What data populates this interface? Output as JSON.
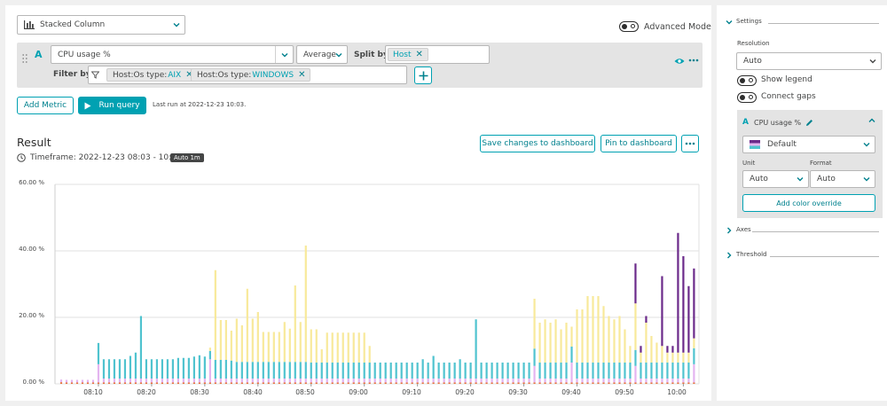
{
  "toolbar": {
    "chart_type": "Stacked Column",
    "advanced_mode": "Advanced Mode"
  },
  "query": {
    "letter": "A",
    "metric": "CPU usage %",
    "aggregation": "Average",
    "split_by_label": "Split by",
    "split_by_value": "Host",
    "filter_by_label": "Filter by",
    "filters": [
      {
        "key": "Host:Os type: ",
        "value": "AIX"
      },
      {
        "key": "Host:Os type: ",
        "value": "WINDOWS"
      }
    ]
  },
  "actions": {
    "add_metric": "Add Metric",
    "run_query": "Run query",
    "last_run": "Last run at 2022-12-23 10:03."
  },
  "result": {
    "title": "Result",
    "timeframe": "Timeframe: 2022-12-23 08:03 - 10:03",
    "resolution_badge": "Auto 1m",
    "save_button": "Save changes to dashboard",
    "pin_button": "Pin to dashboard"
  },
  "colors": {
    "accent": "#00a1b2",
    "cyan": "#4fc3cf",
    "yellow": "#f8e99a",
    "purple": "#6b2a8a",
    "pink": "#e4b4f0",
    "orange": "#e8743b",
    "run_bg": "#00a1b2"
  },
  "settings": {
    "title": "Settings",
    "resolution_label": "Resolution",
    "resolution_value": "Auto",
    "show_legend": "Show legend",
    "connect_gaps": "Connect gaps",
    "series_letter": "A",
    "series_name": "CPU usage %",
    "palette": "Default",
    "unit_label": "Unit",
    "format_label": "Format",
    "unit_value": "Auto",
    "format_value": "Auto",
    "add_color_override": "Add color override",
    "axes": "Axes",
    "threshold": "Threshold"
  },
  "chart_data": {
    "type": "bar",
    "stacked": true,
    "ylim": [
      0,
      60
    ],
    "yticks": [
      "60.00 %",
      "40.00 %",
      "20.00 %",
      "0.00 %"
    ],
    "xticks": [
      "08:10",
      "08:20",
      "08:30",
      "08:40",
      "08:50",
      "09:00",
      "09:10",
      "09:20",
      "09:30",
      "09:40",
      "09:50",
      "10:00"
    ],
    "x_start_minute": 3,
    "series": [
      {
        "color": "#e8743b",
        "values": [
          0.5,
          0.4,
          0.4,
          0.4,
          0.4,
          0.4,
          0.4,
          0.4,
          0.4,
          0.4,
          0.4,
          0.4,
          0.4,
          0.4,
          0.4,
          0.4,
          0.4,
          0.4,
          0.4,
          0.4,
          0.4,
          0.4,
          0.4,
          0.4,
          0.4,
          0.4,
          0.4,
          0.4,
          0.4,
          0.4,
          0.4,
          0.4,
          0.4,
          0.4,
          0.4,
          0.4,
          0.4,
          0.4,
          0.4,
          0.4,
          0.4,
          0.4,
          0.4,
          0.4,
          0.4,
          0.4,
          0.4,
          0.4,
          0.4,
          0.4,
          0.4,
          0.4,
          0.4,
          0.4,
          0.4,
          0.4,
          0.4,
          0.4,
          0.4,
          0.4,
          0.4,
          0.4,
          0.4,
          0.4,
          0.4,
          0.4,
          0.4,
          0.4,
          0.4,
          0.4,
          0.4,
          0.4,
          0.4,
          0.4,
          0.4,
          0.4,
          0.4,
          0.4,
          0.4,
          0.4,
          0.4,
          0.4,
          0.4,
          0.4,
          0.4,
          0.4,
          0.4,
          0.4,
          0.4,
          0.4,
          0.4,
          0.4,
          0.4,
          0.4,
          0.4,
          0.4,
          0.4,
          0.4,
          0.4,
          0.4,
          0.4,
          0.4,
          0.4,
          0.4,
          0.4,
          0.4,
          0.4,
          0.4,
          0.4,
          0.4,
          0.4,
          0.4,
          0.4,
          0.4,
          0.4,
          0.4,
          0.4,
          0.4,
          0.4,
          0.4
        ]
      },
      {
        "color": "#e4b4f0",
        "values": [
          0.8,
          0.8,
          0.8,
          0.8,
          0.8,
          0.8,
          0.8,
          5.5,
          1.2,
          1.2,
          1.2,
          1.2,
          1.2,
          1.2,
          1.2,
          1.2,
          1.2,
          1.2,
          1.2,
          1.2,
          1.2,
          1.2,
          1.2,
          1.2,
          1.2,
          1.2,
          1.2,
          1.2,
          7.0,
          1.2,
          1.2,
          1.2,
          1.2,
          1.2,
          1.2,
          1.2,
          1.2,
          1.2,
          1.2,
          1.2,
          1.2,
          1.2,
          1.2,
          1.2,
          1.2,
          1.2,
          1.2,
          1.2,
          1.2,
          1.2,
          1.2,
          1.2,
          1.2,
          1.2,
          1.2,
          1.2,
          1.2,
          1.2,
          1.2,
          1.2,
          1.2,
          1.2,
          1.2,
          1.2,
          1.2,
          1.2,
          1.2,
          1.2,
          1.2,
          1.2,
          1.2,
          1.2,
          1.2,
          1.2,
          1.2,
          1.2,
          1.2,
          1.2,
          1.2,
          1.2,
          1.2,
          1.2,
          1.2,
          1.2,
          1.2,
          1.2,
          1.2,
          1.2,
          1.2,
          5.0,
          1.2,
          1.2,
          1.2,
          1.2,
          1.2,
          1.2,
          6.0,
          1.2,
          1.2,
          1.2,
          1.2,
          1.2,
          1.2,
          1.2,
          1.2,
          1.2,
          1.2,
          1.2,
          5.0,
          1.2,
          1.2,
          1.2,
          1.2,
          1.2,
          1.2,
          1.2,
          1.2,
          1.2,
          1.2,
          5.5
        ]
      },
      {
        "color": "#4fc3cf",
        "values": [
          0,
          0,
          0,
          0,
          0,
          0,
          0,
          6.4,
          5.8,
          5.8,
          5.8,
          5.8,
          5.8,
          6.8,
          7.8,
          18.8,
          5.8,
          5.8,
          5.8,
          5.8,
          5.8,
          5.8,
          6.2,
          6.2,
          6.2,
          6.6,
          7.0,
          6.6,
          2.5,
          5.6,
          5.6,
          5.6,
          5.4,
          5.0,
          5.0,
          5.0,
          5.0,
          5.0,
          5.0,
          5.0,
          5.0,
          5.0,
          5.0,
          5.0,
          5.0,
          5.0,
          5.0,
          4.8,
          4.8,
          4.8,
          4.8,
          4.8,
          4.8,
          4.8,
          4.8,
          4.8,
          4.8,
          4.8,
          4.8,
          4.8,
          4.8,
          4.8,
          4.8,
          4.8,
          4.8,
          4.8,
          4.8,
          4.8,
          5.8,
          4.8,
          6.8,
          4.8,
          4.8,
          4.8,
          4.8,
          5.8,
          4.8,
          4.8,
          17.8,
          4.8,
          4.8,
          4.8,
          4.8,
          4.8,
          4.8,
          4.8,
          4.8,
          4.8,
          4.8,
          5.2,
          4.8,
          4.8,
          4.8,
          4.8,
          4.8,
          4.8,
          4.8,
          4.8,
          4.8,
          4.8,
          4.8,
          4.8,
          4.8,
          4.8,
          4.8,
          4.8,
          4.8,
          4.8,
          4.8,
          4.8,
          4.8,
          4.8,
          4.8,
          4.8,
          4.8,
          4.8,
          4.8,
          4.8,
          4.8,
          4.8
        ]
      },
      {
        "color": "#f8e99a",
        "values": [
          0,
          0,
          0,
          0,
          0,
          0,
          0,
          0,
          0,
          0,
          0,
          0,
          0,
          0,
          0,
          0,
          0,
          0,
          0,
          0,
          0,
          0,
          0,
          0,
          0,
          0,
          0,
          0,
          1.0,
          27.0,
          12.0,
          12.0,
          9.0,
          13.0,
          11.0,
          22.0,
          13.0,
          15.0,
          9.0,
          9.0,
          9.0,
          9.0,
          12.0,
          10.0,
          23.0,
          12.0,
          35.0,
          10.0,
          10.0,
          4.0,
          9.0,
          9.0,
          9.0,
          9.0,
          9.0,
          9.0,
          9.0,
          9.0,
          5.0,
          0,
          0,
          0,
          0,
          0,
          0,
          0,
          0,
          0,
          0,
          0,
          0,
          0,
          0,
          0,
          0,
          0,
          0,
          0,
          0,
          0,
          0,
          0,
          0,
          0,
          0,
          0,
          0,
          0,
          0,
          15.0,
          12.0,
          13.0,
          12.0,
          13.0,
          10.0,
          12.0,
          6.0,
          16.0,
          16.0,
          20.0,
          20.0,
          20.0,
          17.0,
          14.0,
          13.0,
          14.0,
          10.0,
          5.0,
          14.0,
          3.0,
          12.0,
          8.0,
          6.0,
          5.0,
          3.0,
          3.0,
          3.0,
          3.0,
          3.0,
          3.0
        ]
      },
      {
        "color": "#6b2a8a",
        "values": [
          0,
          0,
          0,
          0,
          0,
          0,
          0,
          0,
          0,
          0,
          0,
          0,
          0,
          0,
          0,
          0,
          0,
          0,
          0,
          0,
          0,
          0,
          0,
          0,
          0,
          0,
          0,
          0,
          0,
          0,
          0,
          0,
          0,
          0,
          0,
          0,
          0,
          0,
          0,
          0,
          0,
          0,
          0,
          0,
          0,
          0,
          0,
          0,
          0,
          0,
          0,
          0,
          0,
          0,
          0,
          0,
          0,
          0,
          0,
          0,
          0,
          0,
          0,
          0,
          0,
          0,
          0,
          0,
          0,
          0,
          0,
          0,
          0,
          0,
          0,
          0,
          0,
          0,
          0,
          0,
          0,
          0,
          0,
          0,
          0,
          0,
          0,
          0,
          0,
          0,
          0,
          0,
          0,
          0,
          0,
          0,
          0,
          0,
          0,
          0,
          0,
          0,
          0,
          0,
          0,
          0,
          0,
          0,
          12.0,
          2.0,
          2.0,
          0,
          0,
          21.0,
          2.0,
          2.0,
          36.0,
          29.0,
          20.0,
          21.0,
          15.0,
          0
        ]
      }
    ]
  }
}
